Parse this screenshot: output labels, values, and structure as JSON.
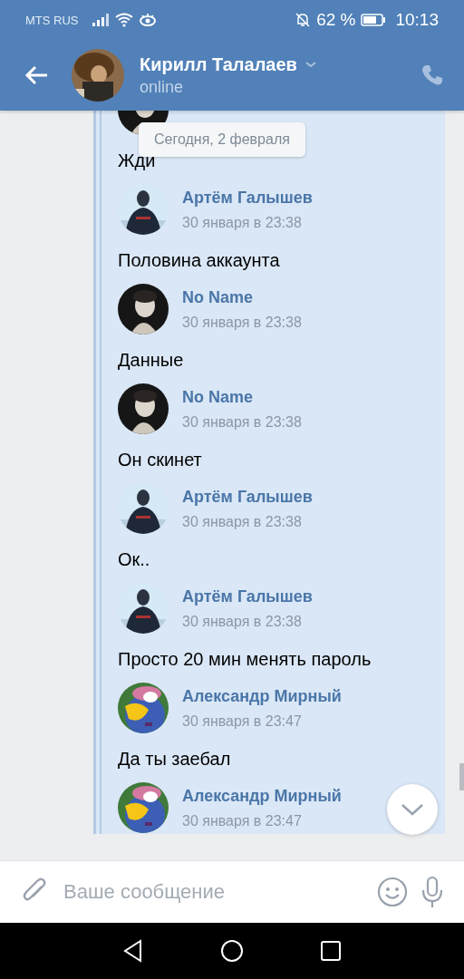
{
  "status_bar": {
    "carrier": "MTS RUS",
    "battery": "62 %",
    "time": "10:13"
  },
  "header": {
    "name": "Кирилл Талалаев",
    "status": "online"
  },
  "date_badge": "Сегодня, 2 февраля",
  "messages": [
    {
      "text": "Жди"
    },
    {
      "name": "Артём Галышев",
      "time": "30 января в 23:38",
      "text": "Половина аккаунта"
    },
    {
      "name": "No Name",
      "time": "30 января в 23:38",
      "text": "Данные"
    },
    {
      "name": "No Name",
      "time": "30 января в 23:38",
      "text": "Он скинет"
    },
    {
      "name": "Артём Галышев",
      "time": "30 января в 23:38",
      "text": "Ок.."
    },
    {
      "name": "Артём Галышев",
      "time": "30 января в 23:38",
      "text": "Просто 20 мин менять пароль"
    },
    {
      "name": "Александр Мирный",
      "time": "30 января в 23:47",
      "text": "Да ты заебал"
    },
    {
      "name": "Александр Мирный",
      "time": "30 января в 23:47"
    }
  ],
  "composer": {
    "placeholder": "Ваше сообщение"
  }
}
